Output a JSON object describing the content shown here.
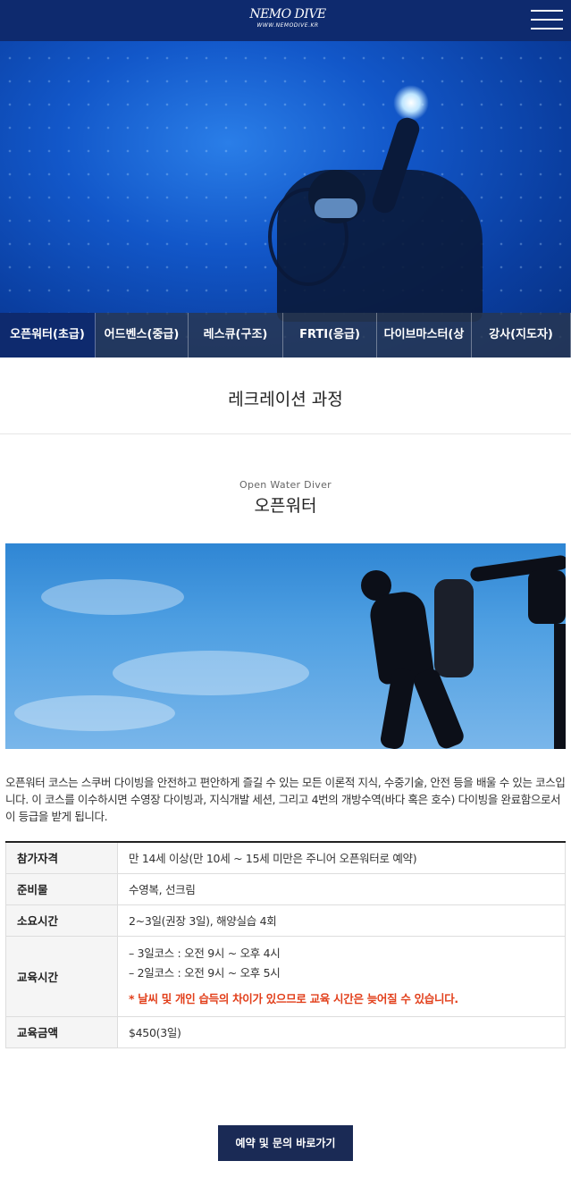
{
  "header": {
    "logo_text": "NEMO DIVE",
    "logo_sub": "WWW.NEMODIVE.KR",
    "menu_icon": "hamburger-menu-icon"
  },
  "tabs": [
    {
      "label": "오픈워터(초급)",
      "active": true
    },
    {
      "label": "어드벤스(중급)",
      "active": false
    },
    {
      "label": "레스큐(구조)",
      "active": false
    },
    {
      "label": "FRTI(응급)",
      "active": false
    },
    {
      "label": "다이브마스터(상",
      "active": false
    },
    {
      "label": "강사(지도자)",
      "active": false
    }
  ],
  "section": {
    "title": "레크레이션 과정"
  },
  "course": {
    "subtitle": "Open Water Diver",
    "title": "오픈워터",
    "description": "오픈워터 코스는 스쿠버 다이빙을 안전하고 편안하게 즐길 수 있는 모든 이론적 지식, 수중기술, 안전 등을 배울 수 있는 코스입니다. 이 코스를 이수하시면 수영장 다이빙과, 지식개발 세션, 그리고 4번의 개방수역(바다 혹은 호수) 다이빙을 완료함으로서 이 등급을 받게 됩니다."
  },
  "table": {
    "rows": [
      {
        "label": "참가자격",
        "value": "만 14세 이상(만 10세 ~ 15세 미만은 주니어 오픈워터로 예약)"
      },
      {
        "label": "준비물",
        "value": "수영복, 선크림"
      },
      {
        "label": "소요시간",
        "value": "2~3일(권장 3일), 해양실습 4회"
      },
      {
        "label": "교육시간",
        "lines": [
          "– 3일코스 : 오전 9시 ~ 오후 4시",
          "– 2일코스 : 오전 9시 ~ 오후 5시"
        ],
        "note": "* 날씨 및 개인 습득의 차이가 있으므로 교육 시간은 늦어질 수 있습니다."
      },
      {
        "label": "교육금액",
        "value": "$450(3일)"
      }
    ]
  },
  "cta": {
    "label": "예약 및 문의 바로가기"
  },
  "colors": {
    "header_bg": "#0e2a6e",
    "active_tab": "#0e2a6e",
    "button_bg": "#1a2a55",
    "warning": "#e2401c"
  }
}
